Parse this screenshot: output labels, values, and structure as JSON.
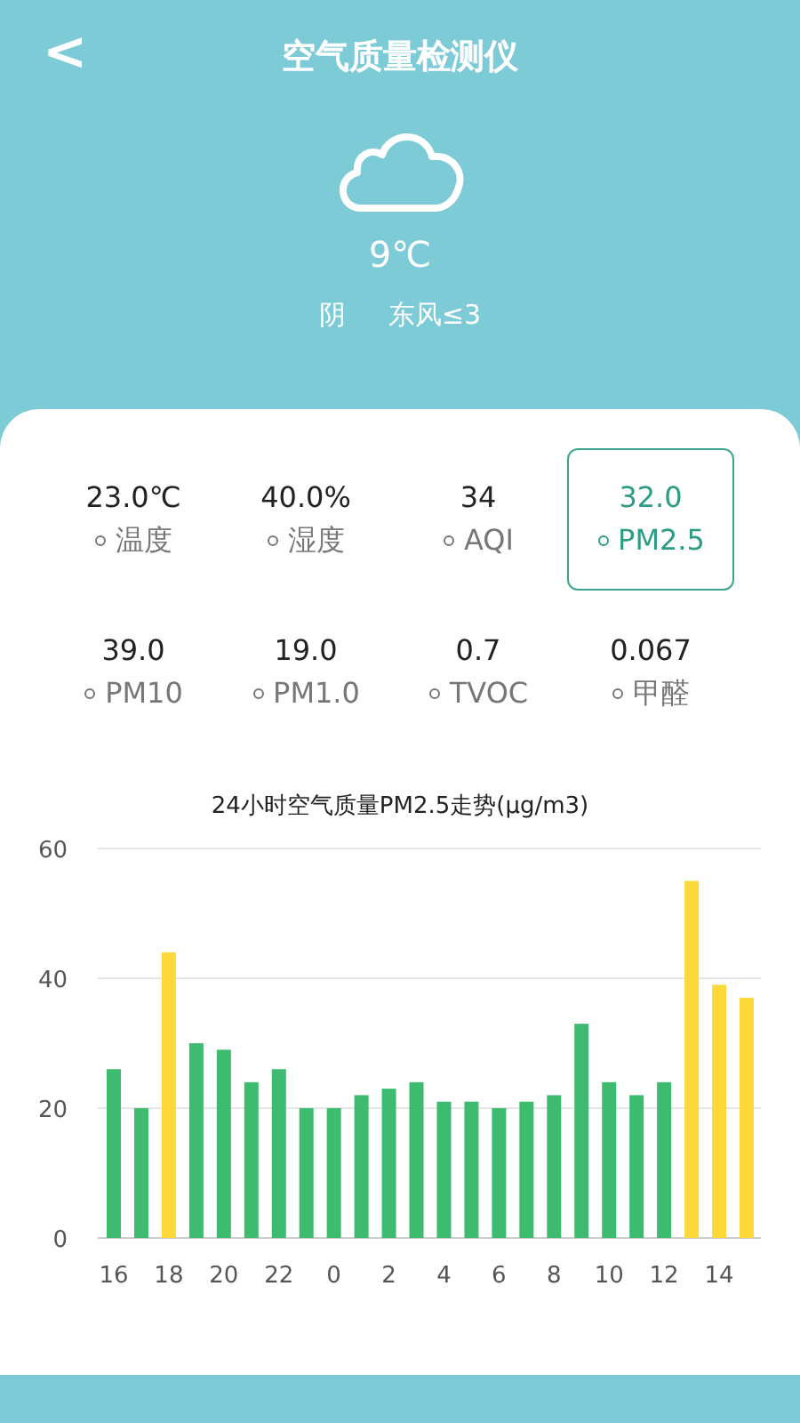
{
  "header": {
    "back": "<",
    "title": "空气质量检测仪"
  },
  "weather": {
    "temperature": "9℃",
    "condition": "阴",
    "wind": "东风≤3"
  },
  "metrics": [
    {
      "value": "23.0℃",
      "label": "温度",
      "selected": false
    },
    {
      "value": "40.0%",
      "label": "湿度",
      "selected": false
    },
    {
      "value": "34",
      "label": "AQI",
      "selected": false
    },
    {
      "value": "32.0",
      "label": "PM2.5",
      "selected": true
    },
    {
      "value": "39.0",
      "label": "PM10",
      "selected": false
    },
    {
      "value": "19.0",
      "label": "PM1.0",
      "selected": false
    },
    {
      "value": "0.7",
      "label": "TVOC",
      "selected": false
    },
    {
      "value": "0.067",
      "label": "甲醛",
      "selected": false
    }
  ],
  "chart": {
    "chart_data": {
      "type": "bar",
      "title": "24小时空气质量PM2.5走势(μg/m3)",
      "categories": [
        "16",
        null,
        "18",
        null,
        "20",
        null,
        "22",
        null,
        "0",
        null,
        "2",
        null,
        "4",
        null,
        "6",
        null,
        "8",
        null,
        "10",
        null,
        "12",
        null,
        "14",
        null
      ],
      "series": [
        {
          "color": "#3dbb6e",
          "values": [
            26,
            20,
            null,
            30,
            29,
            24,
            26,
            20,
            20,
            22,
            23,
            24,
            21,
            21,
            20,
            21,
            22,
            33,
            24,
            22,
            24,
            null,
            null,
            null
          ]
        },
        {
          "color": "#fcd939",
          "values": [
            null,
            null,
            44,
            null,
            null,
            null,
            null,
            null,
            null,
            null,
            null,
            null,
            null,
            null,
            null,
            null,
            null,
            null,
            null,
            null,
            null,
            55,
            39,
            37
          ]
        }
      ],
      "ylim": [
        0,
        60
      ],
      "yticks": [
        0,
        20,
        40,
        60
      ]
    }
  }
}
